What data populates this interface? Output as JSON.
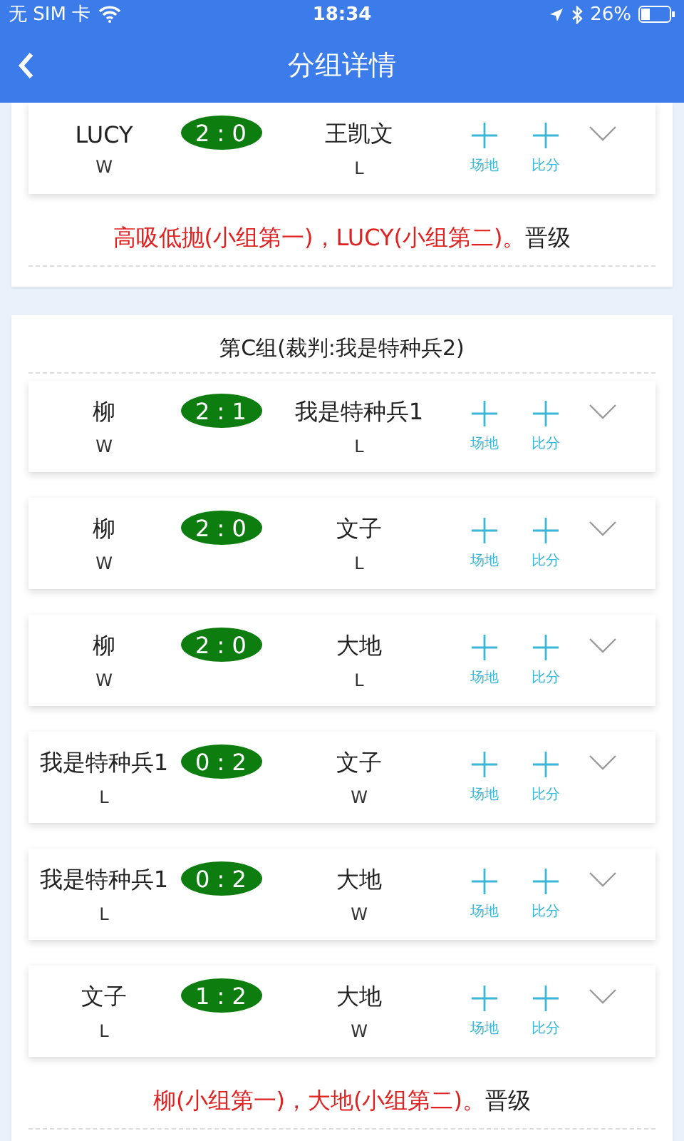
{
  "status_bar": {
    "carrier": "无 SIM 卡",
    "time": "18:34",
    "battery": "26%"
  },
  "nav": {
    "title": "分组详情"
  },
  "groups": [
    {
      "matches": [
        {
          "home": "LUCY",
          "home_result": "W",
          "score": "2 : 0",
          "away": "王凯文",
          "away_result": "L",
          "venue_label": "场地",
          "score_label": "比分"
        }
      ],
      "result": {
        "qualifiers": "高吸低抛(小组第一)，LUCY(小组第二)。",
        "suffix": "晋级"
      }
    },
    {
      "title": "第C组(裁判:我是特种兵2)",
      "matches": [
        {
          "home": "柳",
          "home_result": "W",
          "score": "2 : 1",
          "away": "我是特种兵1",
          "away_result": "L",
          "venue_label": "场地",
          "score_label": "比分"
        },
        {
          "home": "柳",
          "home_result": "W",
          "score": "2 : 0",
          "away": "文子",
          "away_result": "L",
          "venue_label": "场地",
          "score_label": "比分"
        },
        {
          "home": "柳",
          "home_result": "W",
          "score": "2 : 0",
          "away": "大地",
          "away_result": "L",
          "venue_label": "场地",
          "score_label": "比分"
        },
        {
          "home": "我是特种兵1",
          "home_result": "L",
          "score": "0 : 2",
          "away": "文子",
          "away_result": "W",
          "venue_label": "场地",
          "score_label": "比分"
        },
        {
          "home": "我是特种兵1",
          "home_result": "L",
          "score": "0 : 2",
          "away": "大地",
          "away_result": "W",
          "venue_label": "场地",
          "score_label": "比分"
        },
        {
          "home": "文子",
          "home_result": "L",
          "score": "1 : 2",
          "away": "大地",
          "away_result": "W",
          "venue_label": "场地",
          "score_label": "比分"
        }
      ],
      "result": {
        "qualifiers": "柳(小组第一)，大地(小组第二)。",
        "suffix": "晋级"
      }
    }
  ]
}
